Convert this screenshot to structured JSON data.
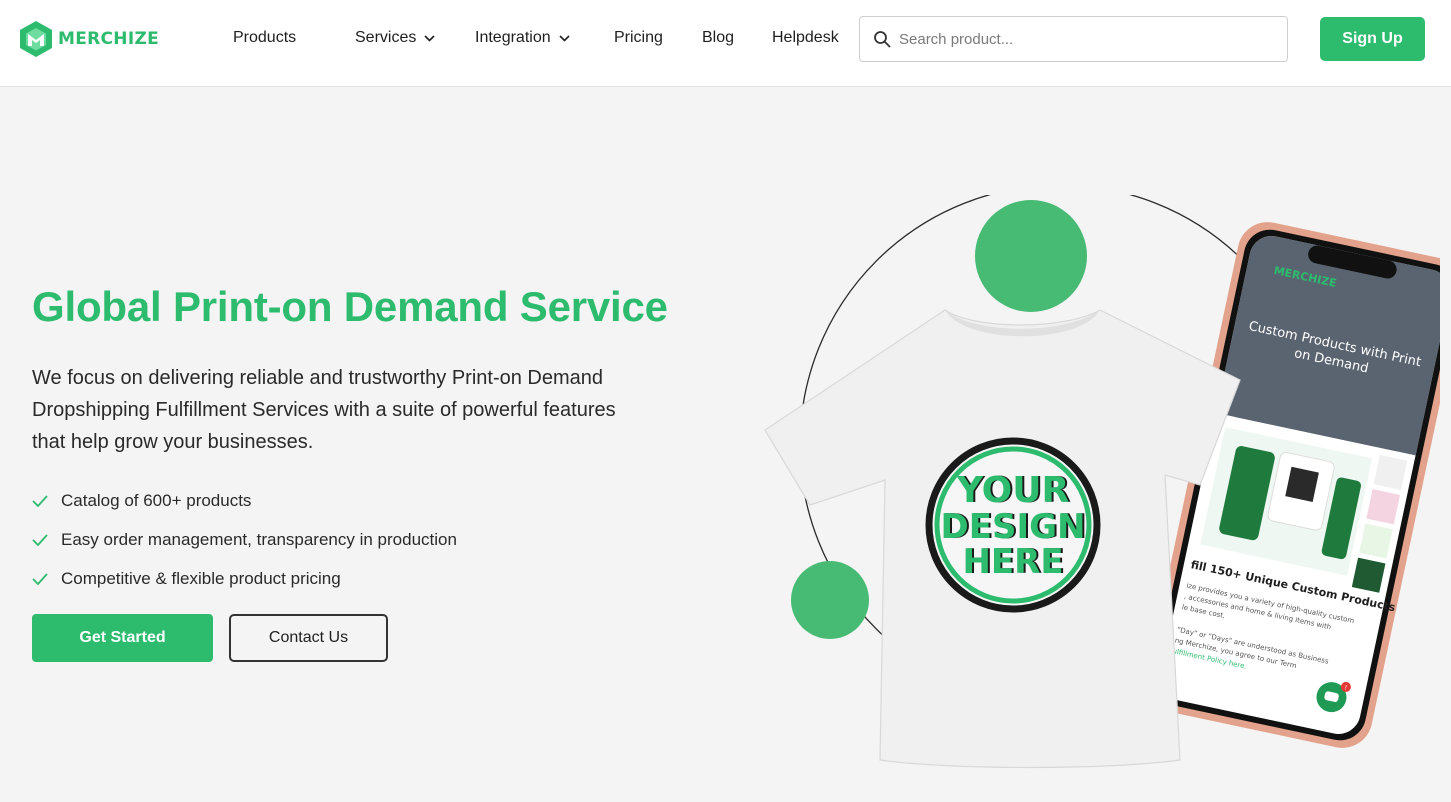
{
  "brand": {
    "name": "MERCHIZE",
    "color": "#2dbb6e"
  },
  "nav": {
    "products": "Products",
    "services": "Services",
    "integration": "Integration",
    "pricing": "Pricing",
    "blog": "Blog",
    "helpdesk": "Helpdesk"
  },
  "search": {
    "placeholder": "Search product...",
    "value": "",
    "icon": "search-icon"
  },
  "header": {
    "signup_label": "Sign Up"
  },
  "hero": {
    "title": "Global Print-on Demand Service",
    "description": "We focus on delivering reliable and trustworthy Print-on Demand Dropshipping Fulfillment Services with a suite of powerful features that help grow your businesses.",
    "features": [
      "Catalog of 600+ products",
      "Easy order management, transparency in production",
      "Competitive & flexible product pricing"
    ],
    "get_started_label": "Get Started",
    "contact_label": "Contact Us"
  },
  "illustration": {
    "shirt_text_line1": "YOUR",
    "shirt_text_line2": "DESIGN",
    "shirt_text_line3": "HERE",
    "phone_brand": "MERCHIZE",
    "phone_banner_line1": "Custom Products with Print",
    "phone_banner_line2": "on Demand",
    "phone_heading": "fill 150+ Unique Custom Products",
    "phone_body_line1": "ize provides you a variety of high-quality custom",
    "phone_body_line2": ", accessories and home & living items with",
    "phone_body_line3": "le base cost.",
    "phone_body_line4": "\"Day\" or \"Days\" are understood as Business",
    "phone_body_line5": "ng Merchize, you agree to our Term",
    "phone_body_line6": "ulfillment Policy here.",
    "chat_badge": "!"
  }
}
